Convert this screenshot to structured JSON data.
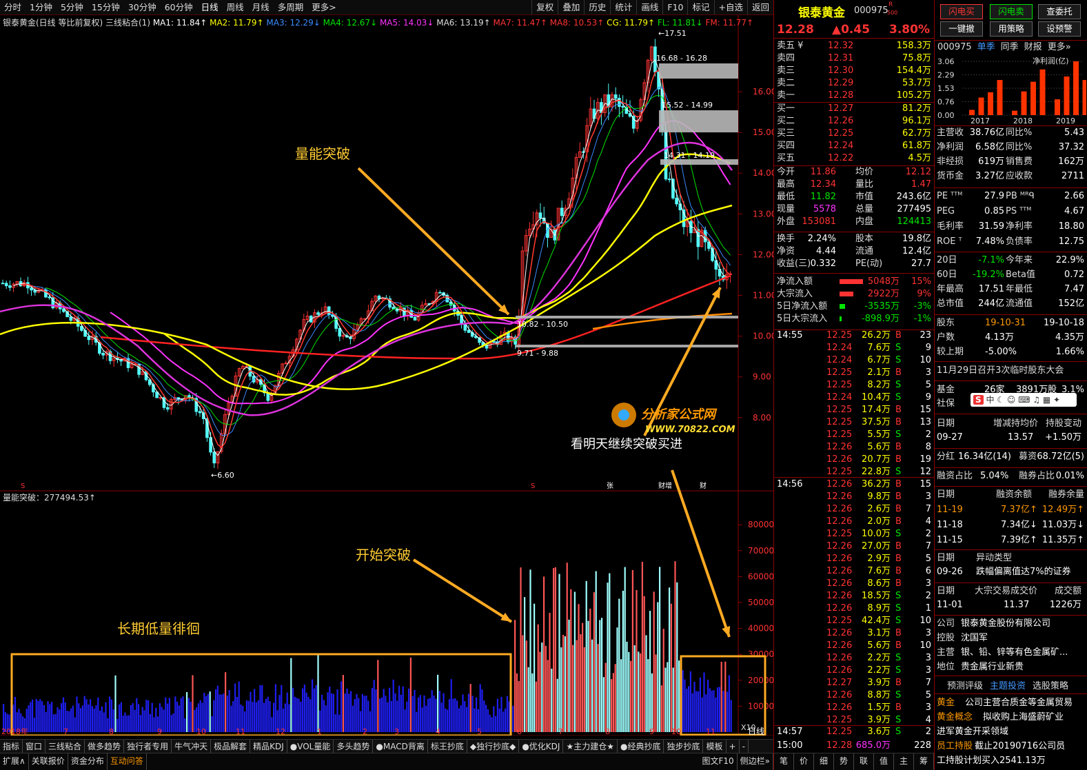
{
  "toolbar": {
    "left": [
      "分时",
      "1分钟",
      "5分钟",
      "15分钟",
      "30分钟",
      "60分钟",
      "日线",
      "周线",
      "月线",
      "多周期",
      "更多>"
    ],
    "right": [
      "复权",
      "叠加",
      "历史",
      "统计",
      "画线",
      "F10",
      "标记",
      "+自选",
      "返回"
    ]
  },
  "ma_legend": {
    "name": "银泰黄金(日线 等比前复权)",
    "set": "三线粘合(1)",
    "items": [
      {
        "t": "MA1: 11.84↑",
        "c": "#fff"
      },
      {
        "t": "MA2: 11.79↑",
        "c": "#ffff00"
      },
      {
        "t": "MA3: 12.29↓",
        "c": "#3b8bff"
      },
      {
        "t": "MA4: 12.67↓",
        "c": "#00e600"
      },
      {
        "t": "MA5: 14.03↓",
        "c": "#ff33ff"
      },
      {
        "t": "MA6: 13.19↑",
        "c": "#ddd"
      },
      {
        "t": "MA7: 11.47↑",
        "c": "#ff3333"
      },
      {
        "t": "MA8: 10.53↑",
        "c": "#ff3333"
      },
      {
        "t": "CG: 11.79↑",
        "c": "#ffff00"
      },
      {
        "t": "FL: 11.81↓",
        "c": "#00e600"
      },
      {
        "t": "FM: 11.77↑",
        "c": "#ff3333"
      }
    ]
  },
  "price_axis": [
    "16.00",
    "15.00",
    "14.00",
    "13.00",
    "12.00",
    "11.00",
    "10.00",
    "9.00",
    "8.00"
  ],
  "vol_axis": [
    "80000",
    "70000",
    "60000",
    "50000",
    "40000",
    "30000",
    "20000",
    "10000"
  ],
  "vol_unit": "X10",
  "chart_labels": {
    "high": "17.51",
    "low": "6.60",
    "zone1": "16.68 - 16.28",
    "zone2": "15.52 - 14.99",
    "zone3": "14.31 - 14.19",
    "zone4": "10.82 - 10.50",
    "zone5": "9.71 - 9.88"
  },
  "annotations": {
    "a1": "量能突破",
    "a2": "开始突破",
    "a3": "长期低量徘徊",
    "a4": "看明天继续突破买进"
  },
  "watermark": {
    "title": "分析家公式网",
    "url": "WWW.70822.COM"
  },
  "vol_indicator": "量能突破：277494.53↑",
  "x_axis": [
    "2018年",
    "7",
    "8",
    "9",
    "10",
    "11",
    "12",
    "1",
    "2",
    "3",
    "4",
    "5",
    "6",
    "7",
    "8",
    "9",
    "10",
    "11"
  ],
  "period": "日线",
  "bottom_tabs": [
    "指标",
    "窗口",
    "三线粘合",
    "做多趋势",
    "独行者专用",
    "牛气冲天",
    "极品解套",
    "精品KDJ",
    "●VOL量能",
    "多头趋势",
    "●MACD背离",
    "标王抄底",
    "◆独行抄底◆",
    "●优化KDJ",
    "★主力建仓★",
    "●经典抄底",
    "独步抄底",
    "模板",
    "+",
    "-"
  ],
  "bottom_tabs2": [
    "扩展∧",
    "关联报价",
    "资金分布",
    "互动问答"
  ],
  "bottom_right": [
    "图文F10",
    "侧边栏»",
    "笔",
    "价",
    "细",
    "势",
    "联",
    "值",
    "主",
    "筹"
  ],
  "stock": {
    "name": "银泰黄金",
    "code": "000975",
    "badge": "R",
    "badge2": "500",
    "price": "12.28",
    "change": "▲0.45",
    "pct": "3.80%"
  },
  "asks": [
    {
      "l": "卖五 ¥",
      "p": "12.32",
      "v": "158.3万"
    },
    {
      "l": "卖四",
      "p": "12.31",
      "v": "75.8万"
    },
    {
      "l": "卖三",
      "p": "12.30",
      "v": "154.4万"
    },
    {
      "l": "卖二",
      "p": "12.29",
      "v": "53.7万"
    },
    {
      "l": "卖一",
      "p": "12.28",
      "v": "105.2万"
    }
  ],
  "bids": [
    {
      "l": "买一",
      "p": "12.27",
      "v": "81.2万"
    },
    {
      "l": "买二",
      "p": "12.26",
      "v": "96.1万"
    },
    {
      "l": "买三",
      "p": "12.25",
      "v": "62.7万"
    },
    {
      "l": "买四",
      "p": "12.24",
      "v": "61.8万"
    },
    {
      "l": "买五",
      "p": "12.22",
      "v": "4.5万"
    }
  ],
  "stats": [
    [
      "今开",
      "11.86",
      "red",
      "均价",
      "12.12",
      "red"
    ],
    [
      "最高",
      "12.34",
      "red",
      "量比",
      "1.47",
      "red"
    ],
    [
      "最低",
      "11.82",
      "grn",
      "市值",
      "243.6亿",
      "wht"
    ],
    [
      "现量",
      "5578",
      "mag",
      "总量",
      "277495",
      "wht"
    ],
    [
      "外盘",
      "153081",
      "red",
      "内盘",
      "124413",
      "grn"
    ]
  ],
  "stats2": [
    [
      "换手",
      "2.24%",
      "股本",
      "19.8亿"
    ],
    [
      "净资",
      "4.44",
      "流通",
      "12.4亿"
    ],
    [
      "收益(三)",
      "0.332",
      "PE(动)",
      "27.7"
    ]
  ],
  "flows": [
    {
      "l": "净流入额",
      "v": "5048万",
      "p": "15%",
      "c": "red",
      "w": 34
    },
    {
      "l": "大宗流入",
      "v": "2922万",
      "p": "9%",
      "c": "red",
      "w": 20
    },
    {
      "l": "5日净流入额",
      "v": "-3535万",
      "p": "-3%",
      "c": "grn",
      "w": 8
    },
    {
      "l": "5日大宗流入",
      "v": "-898.9万",
      "p": "-1%",
      "c": "grn",
      "w": 3
    }
  ],
  "ticks1": {
    "time": "14:55",
    "rows": [
      [
        "12.25",
        "26.2万",
        "B",
        "23"
      ],
      [
        "12.24",
        "7.6万",
        "S",
        "9"
      ],
      [
        "12.24",
        "6.7万",
        "S",
        "10"
      ],
      [
        "12.25",
        "2.1万",
        "B",
        "3"
      ],
      [
        "12.25",
        "8.2万",
        "S",
        "5"
      ],
      [
        "12.24",
        "10.4万",
        "S",
        "9"
      ],
      [
        "12.25",
        "17.4万",
        "B",
        "15"
      ],
      [
        "12.25",
        "37.5万",
        "B",
        "13"
      ],
      [
        "12.25",
        "5.5万",
        "S",
        "2"
      ],
      [
        "12.26",
        "5.6万",
        "B",
        "8"
      ],
      [
        "12.26",
        "20.7万",
        "B",
        "19"
      ],
      [
        "12.25",
        "22.8万",
        "S",
        "12"
      ]
    ]
  },
  "ticks2": {
    "time": "14:56",
    "rows": [
      [
        "12.26",
        "36.2万",
        "B",
        "15"
      ],
      [
        "12.26",
        "9.8万",
        "B",
        "3"
      ],
      [
        "12.26",
        "2.6万",
        "B",
        "7"
      ],
      [
        "12.26",
        "2.0万",
        "B",
        "4"
      ],
      [
        "12.25",
        "10.0万",
        "S",
        "2"
      ],
      [
        "12.26",
        "27.0万",
        "B",
        "7"
      ],
      [
        "12.26",
        "2.9万",
        "B",
        "5"
      ],
      [
        "12.26",
        "7.6万",
        "B",
        "6"
      ],
      [
        "12.26",
        "8.6万",
        "B",
        "3"
      ],
      [
        "12.26",
        "18.5万",
        "S",
        "2"
      ],
      [
        "12.26",
        "8.9万",
        "S",
        "1"
      ],
      [
        "12.25",
        "42.4万",
        "S",
        "10"
      ],
      [
        "12.26",
        "3.1万",
        "B",
        "3"
      ],
      [
        "12.26",
        "5.6万",
        "B",
        "10"
      ],
      [
        "12.26",
        "2.2万",
        "S",
        "3"
      ],
      [
        "12.26",
        "2.2万",
        "S",
        "3"
      ],
      [
        "12.27",
        "3.9万",
        "B",
        "7"
      ],
      [
        "12.26",
        "8.8万",
        "S",
        "5"
      ],
      [
        "12.26",
        "1.5万",
        "B",
        "3"
      ],
      [
        "12.25",
        "3.9万",
        "S",
        "4"
      ]
    ]
  },
  "ticks3": [
    {
      "time": "14:57",
      "p": "12.25",
      "v": "3.6万",
      "s": "S",
      "n": "2"
    },
    {
      "time": "15:00",
      "p": "12.28",
      "v": "685.0万",
      "s": "",
      "n": "228"
    }
  ],
  "fbtn": [
    "闪电买",
    "闪电卖",
    "查委托",
    "一键撤",
    "用策略",
    "设预警"
  ],
  "ftabs": [
    "000975",
    "单季",
    "同季",
    "财报",
    "更多»"
  ],
  "fchart": {
    "y": [
      "3.06",
      "2.29",
      "1.53",
      "0.76",
      "0.00"
    ],
    "x": [
      "2017",
      "2018",
      "2019"
    ],
    "label": "净利润(亿)",
    "values": [
      0.3,
      1.0,
      1.3,
      2.0,
      0.25,
      1.35,
      1.9,
      2.6,
      0.9,
      2.2,
      3.06,
      2.0
    ]
  },
  "fin": [
    [
      "主营收",
      "38.76亿",
      "同比%",
      "5.43"
    ],
    [
      "净利润",
      "6.58亿",
      "同比%",
      "37.32"
    ],
    [
      "非经损",
      "619万",
      "销售费",
      "162万"
    ],
    [
      "货币金",
      "3.27亿",
      "应收款",
      "2711"
    ]
  ],
  "fin2": [
    [
      "PE ᵀᵀᴹ",
      "27.9",
      "PB ᴹᴿᑫ",
      "2.66"
    ],
    [
      "PEG",
      "0.85",
      "PS ᵀᵀᴹ",
      "4.67"
    ],
    [
      "毛利率",
      "31.59",
      "净利率",
      "18.80"
    ],
    [
      "ROE ᵀ",
      "7.48%",
      "负债率",
      "12.75"
    ]
  ],
  "fin3": [
    [
      "20日",
      "-7.1%",
      "今年来",
      "22.9%"
    ],
    [
      "60日",
      "-19.2%",
      "Beta值",
      "0.72"
    ],
    [
      "年最高",
      "17.51",
      "年最低",
      "7.47"
    ],
    [
      "总市值",
      "244亿",
      "流通值",
      "152亿"
    ]
  ],
  "holders": [
    [
      "股东",
      "19-10-31",
      "19-10-18"
    ],
    [
      "户数",
      "4.13万",
      "4.35万"
    ],
    [
      "较上期",
      "-5.00%",
      "1.66%"
    ]
  ],
  "notice": "11月29日召开3次临时股东大会",
  "funds": [
    [
      "基金",
      "26家",
      "3891万股",
      "3.1%"
    ],
    [
      "社保",
      "",
      "",
      ""
    ]
  ],
  "ime": "中",
  "zc": {
    "h": [
      "日期",
      "增减持均价",
      "持股变动"
    ],
    "r": [
      "09-27",
      "13.57",
      "+1.50万"
    ]
  },
  "fh": [
    "分红",
    "16.34亿(14)",
    "募资",
    "68.72亿(5)"
  ],
  "rz": [
    "融资占比",
    "5.04%",
    "融券占比",
    "0.01%"
  ],
  "margin": {
    "h": [
      "日期",
      "融资余额",
      "融券余量"
    ],
    "r": [
      [
        "11-19",
        "7.37亿↑",
        "12.49万↑"
      ],
      [
        "11-18",
        "7.34亿↓",
        "11.03万↓"
      ],
      [
        "11-15",
        "7.39亿↑",
        "11.35万↑"
      ]
    ]
  },
  "yd": {
    "h": [
      "日期",
      "异动类型"
    ],
    "r": [
      "09-26",
      "跌幅偏离值达7%的证券"
    ]
  },
  "dz": {
    "h": [
      "日期",
      "大宗交易成交价",
      "成交额"
    ],
    "r": [
      "11-01",
      "11.37",
      "1226万"
    ]
  },
  "company": [
    [
      "公司",
      "银泰黄金股份有限公司"
    ],
    [
      "控股",
      "沈国军"
    ],
    [
      "主营",
      "银、铅、锌等有色金属矿..."
    ],
    [
      "地位",
      "贵金属行业新贵"
    ]
  ],
  "ftabs2": [
    "预测评级",
    "主题投资",
    "选股策略"
  ],
  "topics": [
    [
      "黄金",
      "公司主营合质金等金属贸易"
    ],
    [
      "黄金概念",
      "拟收购上海盛蔚矿业"
    ],
    [
      "进军黄金开采领域",
      ""
    ],
    [
      "员工持股",
      "截止20190716公司员"
    ],
    [
      "工持股计划买入2541.13万",
      ""
    ]
  ]
}
